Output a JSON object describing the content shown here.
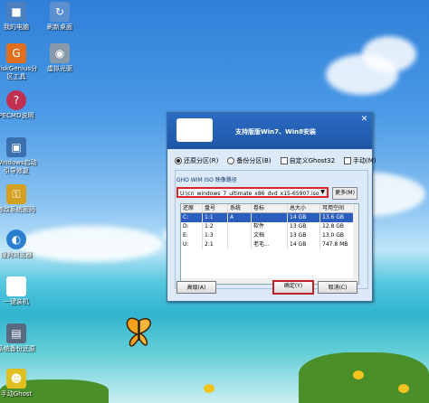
{
  "desktop_icons": [
    {
      "label": "我的电脑",
      "icon": "computer-icon",
      "color": "#4a7fc0"
    },
    {
      "label": "刷新桌面",
      "icon": "refresh-icon",
      "color": "#5a8fd0"
    },
    {
      "label": "DiskGenius分区工具",
      "icon": "diskgenius-icon",
      "color": "#e07020"
    },
    {
      "label": "虚拟光驱",
      "icon": "virtual-drive-icon",
      "color": "#8899aa"
    },
    {
      "label": "PECMD说明",
      "icon": "help-icon",
      "color": "#c03050"
    },
    {
      "label": "Windows启动引导修复",
      "icon": "boot-repair-icon",
      "color": "#3a6fb0"
    },
    {
      "label": "修改系统密码",
      "icon": "key-icon",
      "color": "#d4a020"
    },
    {
      "label": "搜狗浏览器",
      "icon": "browser-icon",
      "color": "#2a7fd0"
    },
    {
      "label": "一键装机",
      "icon": "install-icon",
      "color": "#ffffff"
    },
    {
      "label": "系统备份还原",
      "icon": "backup-icon",
      "color": "#5a6a80"
    },
    {
      "label": "手动Ghost",
      "icon": "ghost-icon",
      "color": "#e0c020"
    }
  ],
  "dialog": {
    "title": "支持版版Win7、Win8安装",
    "close": "✕",
    "options": [
      {
        "label": "还原分区(R)",
        "type": "radio",
        "selected": true
      },
      {
        "label": "备份分区(B)",
        "type": "radio",
        "selected": false
      },
      {
        "label": "自定义Ghost32",
        "type": "checkbox",
        "selected": false
      },
      {
        "label": "手动(M)",
        "type": "checkbox",
        "selected": false
      }
    ],
    "path_label": "GHO WIM ISO 映像路径",
    "path_value": "U:\\cn_windows_7_ultimate_x86_dvd_x15-65907.iso",
    "more_button": "更多(M)",
    "table": {
      "headers": [
        "还原",
        "盘号",
        "系统",
        "卷标",
        "总大小",
        "可用空间"
      ],
      "rows": [
        [
          "C:",
          "1:1",
          "A",
          "",
          "14 GB",
          "13.6 GB"
        ],
        [
          "D:",
          "1:2",
          "",
          "软件",
          "13 GB",
          "12.8 GB"
        ],
        [
          "E:",
          "1:3",
          "",
          "文档",
          "13 GB",
          "13.0 GB"
        ],
        [
          "U:",
          "2:1",
          "",
          "老毛...",
          "14 GB",
          "747.8 MB"
        ]
      ]
    },
    "advanced_button": "高级(A)",
    "ok_button": "确定(Y)",
    "cancel_button": "取消(C)"
  }
}
